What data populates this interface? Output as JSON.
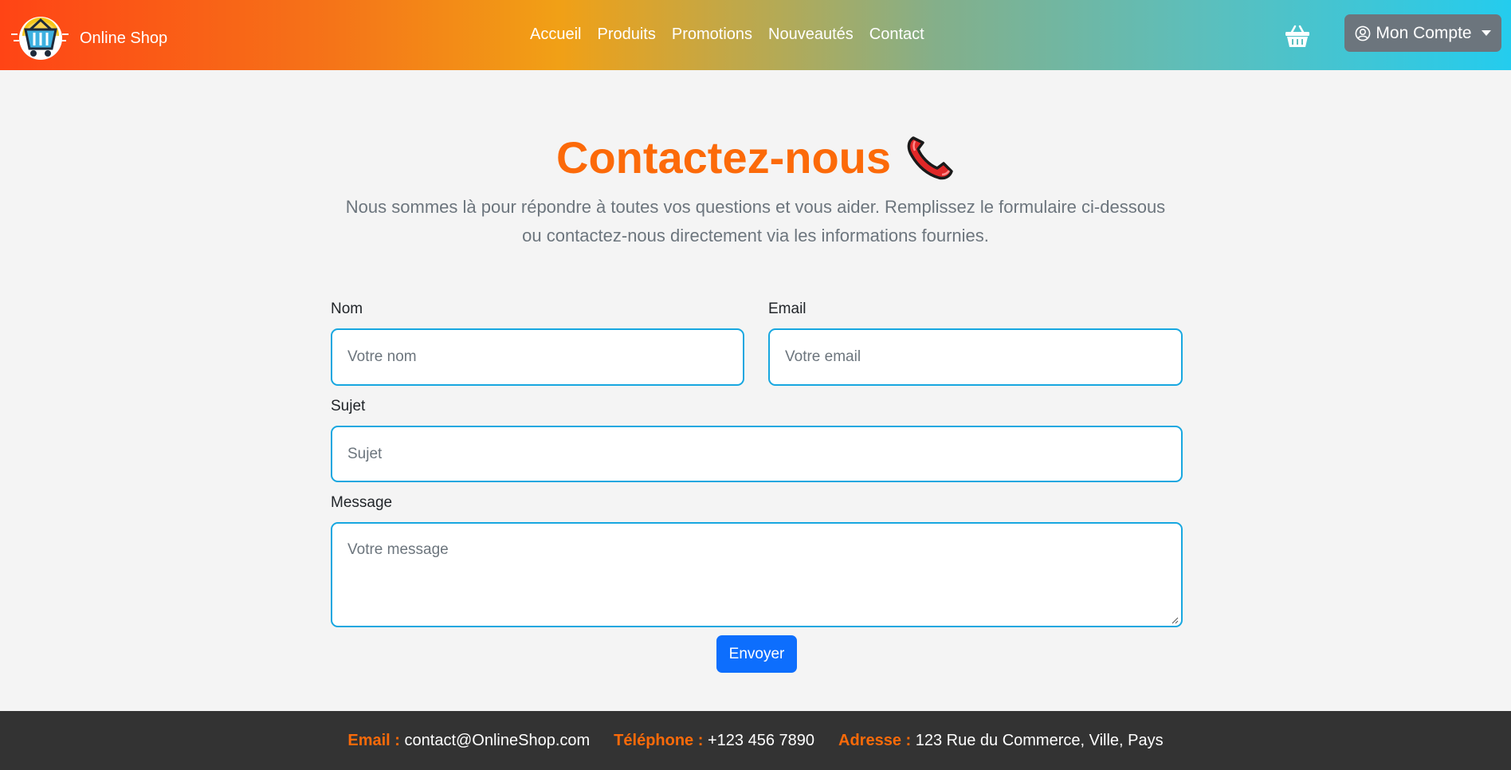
{
  "header": {
    "brand": "Online Shop",
    "nav": [
      "Accueil",
      "Produits",
      "Promotions",
      "Nouveautés",
      "Contact"
    ],
    "account_label": "Mon Compte",
    "icons": {
      "logo": "shopping-basket-logo",
      "cart": "basket-icon",
      "account": "user-circle-icon",
      "caret": "caret-down-icon"
    }
  },
  "hero": {
    "title": "Contactez-nous",
    "icon": "telephone-receiver-icon",
    "intro": "Nous sommes là pour répondre à toutes vos questions et vous aider. Remplissez le formulaire ci-dessous ou contactez-nous directement via les informations fournies."
  },
  "form": {
    "nom_label": "Nom",
    "nom_placeholder": "Votre nom",
    "email_label": "Email",
    "email_placeholder": "Votre email",
    "sujet_label": "Sujet",
    "sujet_placeholder": "Sujet",
    "message_label": "Message",
    "message_placeholder": "Votre message",
    "submit": "Envoyer"
  },
  "footer": {
    "email_label": "Email :",
    "email_value": "contact@OnlineShop.com",
    "phone_label": "Téléphone :",
    "phone_value": "+123 456 7890",
    "address_label": "Adresse :",
    "address_value": "123 Rue du Commerce, Ville, Pays"
  },
  "colors": {
    "accent_orange": "#fc6a09",
    "field_border": "#17a7e0",
    "submit_blue": "#0d6efd",
    "footer_bg": "#333333",
    "account_bg": "#6c757d"
  }
}
